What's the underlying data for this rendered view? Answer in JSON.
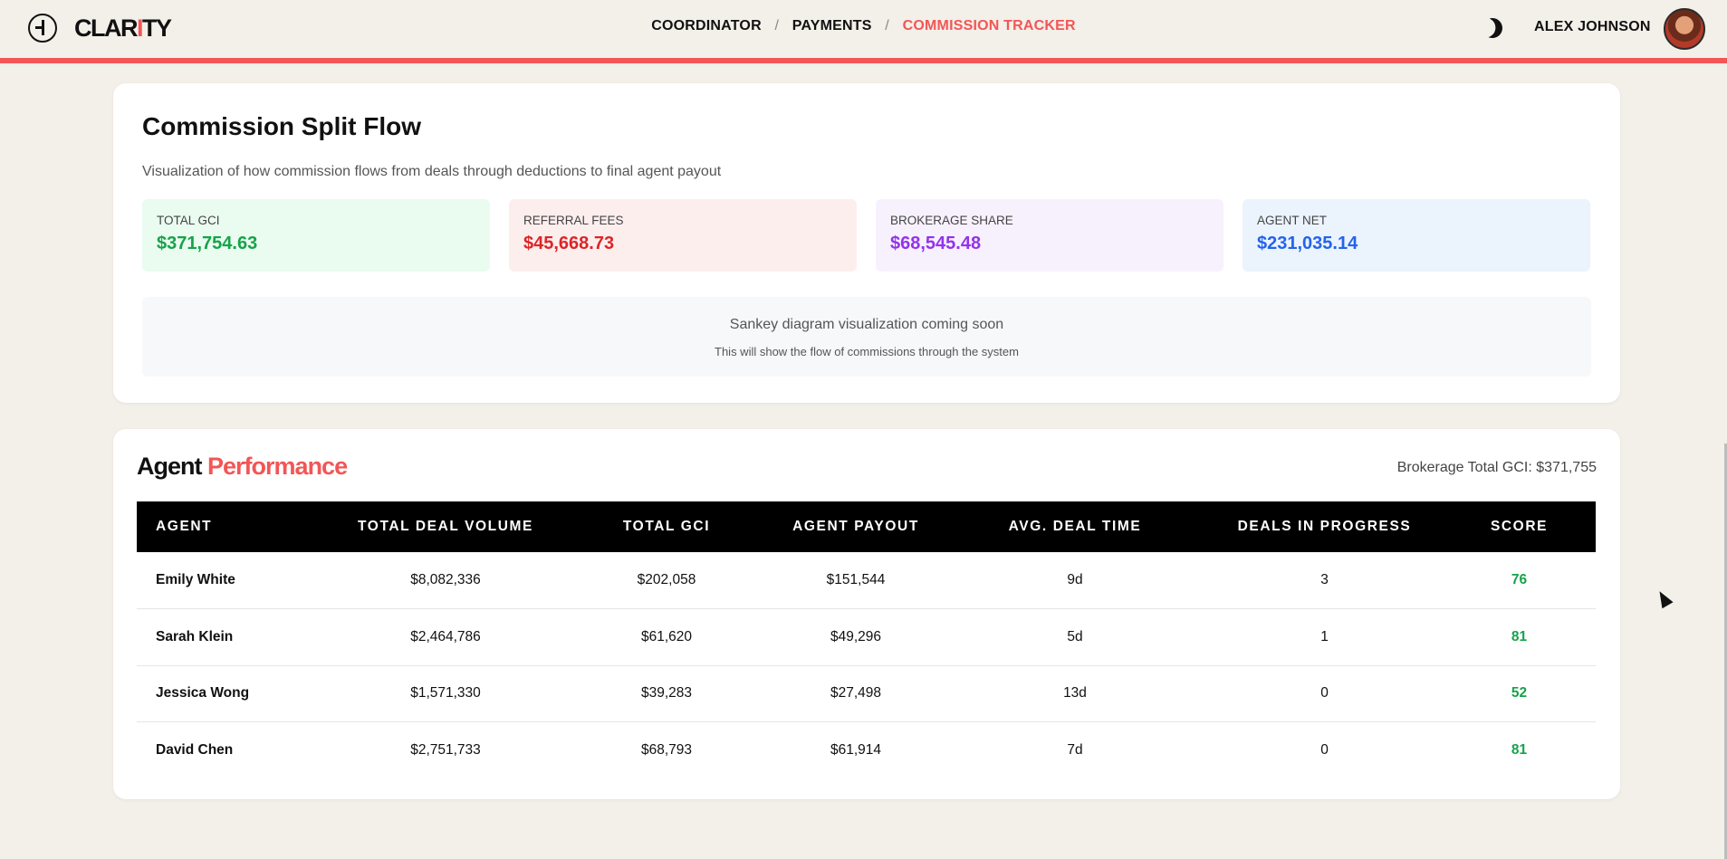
{
  "header": {
    "logo_prefix": "CLAR",
    "logo_accent": "I",
    "logo_suffix": "TY",
    "breadcrumb": [
      "COORDINATOR",
      "PAYMENTS",
      "COMMISSION TRACKER"
    ],
    "separator": "/",
    "user_name": "ALEX JOHNSON",
    "accent_color": "#f25656"
  },
  "split_flow": {
    "title": "Commission Split Flow",
    "subtitle": "Visualization of how commission flows from deals through deductions to final agent payout",
    "stats": [
      {
        "label": "TOTAL GCI",
        "value": "$371,754.63",
        "color": "#16a34a"
      },
      {
        "label": "REFERRAL FEES",
        "value": "$45,668.73",
        "color": "#dc2626"
      },
      {
        "label": "BROKERAGE SHARE",
        "value": "$68,545.48",
        "color": "#9333ea"
      },
      {
        "label": "AGENT NET",
        "value": "$231,035.14",
        "color": "#2563eb"
      }
    ],
    "placeholder_title": "Sankey diagram visualization coming soon",
    "placeholder_sub": "This will show the flow of commissions through the system"
  },
  "performance": {
    "title_part1": "Agent",
    "title_part2": "Performance",
    "brokerage_total": "Brokerage Total GCI: $371,755",
    "columns": [
      "AGENT",
      "TOTAL DEAL VOLUME",
      "TOTAL GCI",
      "AGENT PAYOUT",
      "AVG. DEAL TIME",
      "DEALS IN PROGRESS",
      "SCORE"
    ],
    "rows": [
      {
        "agent": "Emily White",
        "volume": "$8,082,336",
        "gci": "$202,058",
        "payout": "$151,544",
        "time": "9d",
        "progress": "3",
        "score": "76"
      },
      {
        "agent": "Sarah Klein",
        "volume": "$2,464,786",
        "gci": "$61,620",
        "payout": "$49,296",
        "time": "5d",
        "progress": "1",
        "score": "81"
      },
      {
        "agent": "Jessica Wong",
        "volume": "$1,571,330",
        "gci": "$39,283",
        "payout": "$27,498",
        "time": "13d",
        "progress": "0",
        "score": "52"
      },
      {
        "agent": "David Chen",
        "volume": "$2,751,733",
        "gci": "$68,793",
        "payout": "$61,914",
        "time": "7d",
        "progress": "0",
        "score": "81"
      }
    ]
  }
}
